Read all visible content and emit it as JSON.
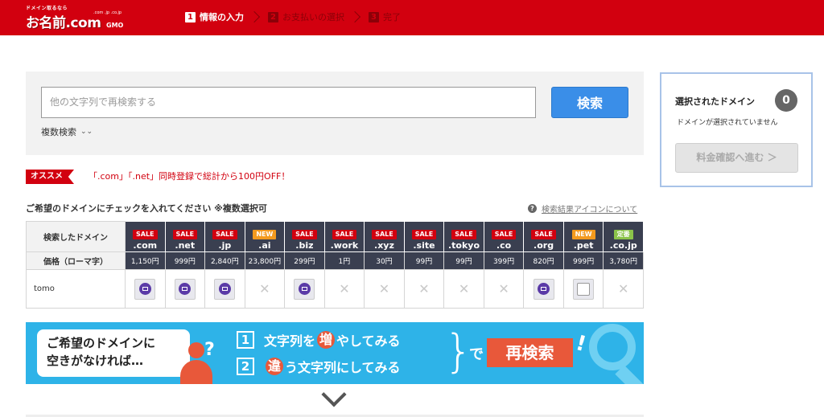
{
  "header": {
    "logo_tagline": "ドメイン取るなら",
    "logo_name": "お名前.com",
    "logo_tlds": ".com .jp .co.jp",
    "logo_brand": "GMO",
    "steps": [
      {
        "num": "1",
        "label": "情報の入力",
        "active": true
      },
      {
        "num": "2",
        "label": "お支払いの選択",
        "active": false
      },
      {
        "num": "3",
        "label": "完了",
        "active": false
      }
    ]
  },
  "search": {
    "placeholder": "他の文字列で再検索する",
    "button_label": "検索",
    "multi_label": "複数検索"
  },
  "recommend": {
    "badge": "オススメ",
    "text": "「.com」「.net」同時登録で総計から100円OFF！"
  },
  "instructions": "ご希望のドメインにチェックを入れてください ※複数選択可",
  "icon_help_link": "検索結果アイコンについて",
  "table": {
    "row_label_search": "検索したドメイン",
    "row_label_price": "価格（ローマ字）",
    "domains": [
      {
        "badge": "SALE",
        "tld": ".com",
        "price": "1,150円",
        "status": "mail"
      },
      {
        "badge": "SALE",
        "tld": ".net",
        "price": "999円",
        "status": "mail"
      },
      {
        "badge": "SALE",
        "tld": ".jp",
        "price": "2,840円",
        "status": "mail"
      },
      {
        "badge": "NEW",
        "tld": ".ai",
        "price": "23,800円",
        "status": "x"
      },
      {
        "badge": "SALE",
        "tld": ".biz",
        "price": "299円",
        "status": "mail"
      },
      {
        "badge": "SALE",
        "tld": ".work",
        "price": "1円",
        "status": "x"
      },
      {
        "badge": "SALE",
        "tld": ".xyz",
        "price": "30円",
        "status": "x"
      },
      {
        "badge": "SALE",
        "tld": ".site",
        "price": "99円",
        "status": "x"
      },
      {
        "badge": "SALE",
        "tld": ".tokyo",
        "price": "99円",
        "status": "x"
      },
      {
        "badge": "SALE",
        "tld": ".co",
        "price": "399円",
        "status": "x"
      },
      {
        "badge": "SALE",
        "tld": ".org",
        "price": "820円",
        "status": "mail"
      },
      {
        "badge": "NEW",
        "tld": ".pet",
        "price": "999円",
        "status": "checkbox"
      },
      {
        "badge": "定番",
        "tld": ".co.jp",
        "price": "3,780円",
        "status": "x"
      }
    ],
    "query": "tomo"
  },
  "badge_colors": {
    "SALE": "#d2000f",
    "NEW": "#f39a1e",
    "定番": "#8bc34a"
  },
  "banner": {
    "line1": "ご希望のドメインに",
    "line2": "空きがなければ…",
    "q": "?",
    "opt1_num": "1",
    "opt1_a": "文字列を",
    "opt1_circ": "増",
    "opt1_b": "やしてみる",
    "opt2_num": "2",
    "opt2_circ": "違",
    "opt2_b": "う文字列にしてみる",
    "brace": "}",
    "de": "で",
    "research": "再検索",
    "excl": "!"
  },
  "side": {
    "title": "選択されたドメイン",
    "count": "0",
    "subtitle": "ドメインが選択されていません",
    "confirm_label": "料金確認へ進む ＞"
  }
}
